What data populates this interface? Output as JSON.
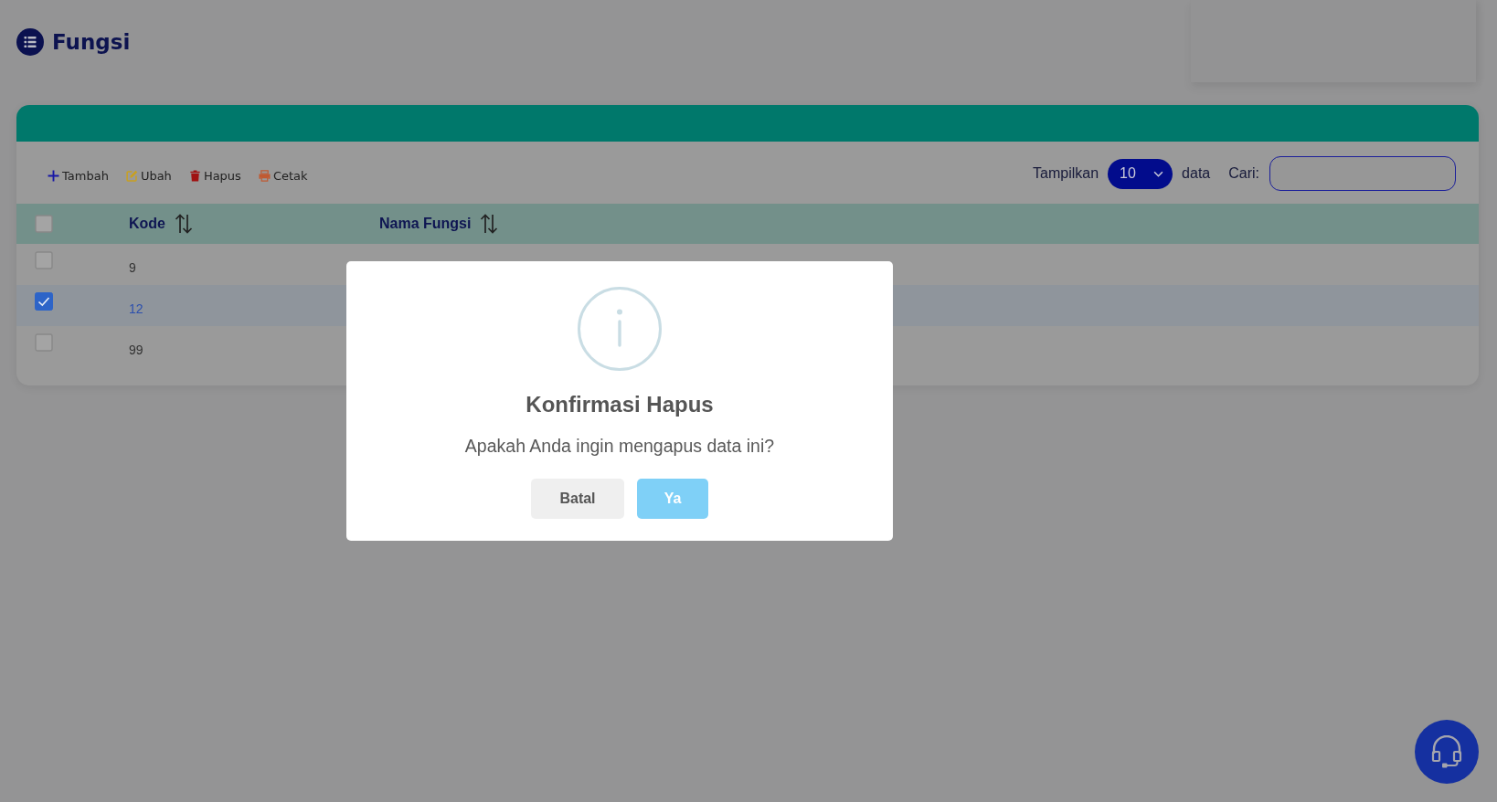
{
  "page": {
    "title": "Fungsi"
  },
  "toolbar": {
    "actions": [
      {
        "label": "Tambah",
        "kind": "add"
      },
      {
        "label": "Ubah",
        "kind": "edit"
      },
      {
        "label": "Hapus",
        "kind": "delete"
      },
      {
        "label": "Cetak",
        "kind": "print"
      }
    ],
    "page_size": {
      "label": "Tampilkan",
      "value": "10",
      "suffix": "data"
    },
    "search": {
      "label": "Cari:"
    }
  },
  "table": {
    "select_all": {
      "checked": false
    },
    "columns": [
      {
        "label": "Kode"
      },
      {
        "label": "Nama Fungsi"
      }
    ],
    "rows": [
      {
        "kode": "9",
        "selected": false
      },
      {
        "kode": "12",
        "selected": true
      },
      {
        "kode": "99",
        "selected": false
      }
    ]
  },
  "dialog": {
    "title": "Konfirmasi Hapus",
    "message": "Apakah Anda ingin mengapus data ini?",
    "buttons": [
      {
        "label": "Batal",
        "kind": "cancel"
      },
      {
        "label": "Ya",
        "kind": "confirm"
      }
    ]
  }
}
